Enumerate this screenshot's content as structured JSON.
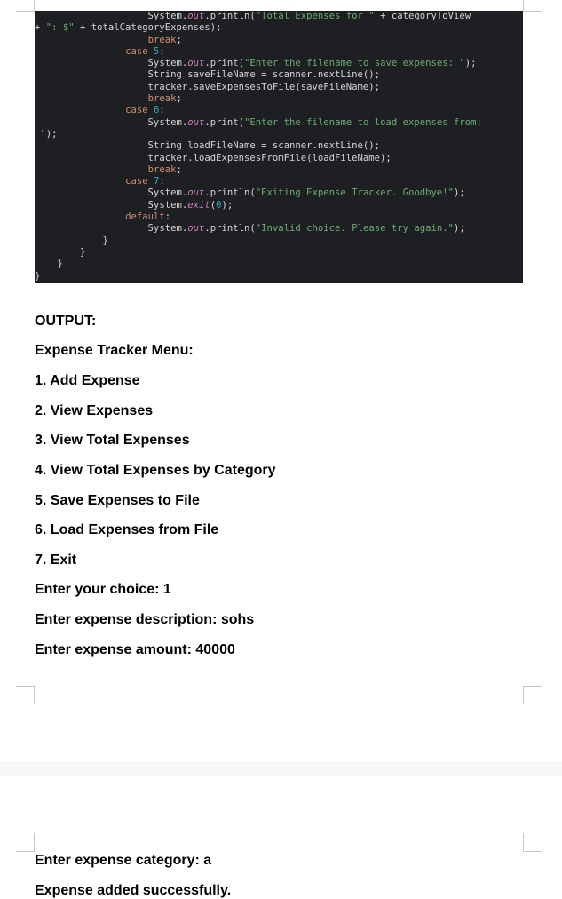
{
  "code_lines": [
    [
      {
        "t": "                    System."
      },
      {
        "t": "out",
        "c": "fld"
      },
      {
        "t": ".println("
      },
      {
        "t": "\"Total Expenses for \"",
        "c": "str"
      },
      {
        "t": " + categoryToView"
      }
    ],
    [
      {
        "t": "+ "
      },
      {
        "t": "\": $\"",
        "c": "str"
      },
      {
        "t": " + totalCategoryExpenses);"
      }
    ],
    [
      {
        "t": "                    "
      },
      {
        "t": "break",
        "c": "kw"
      },
      {
        "t": ";"
      }
    ],
    [
      {
        "t": "                "
      },
      {
        "t": "case ",
        "c": "kw"
      },
      {
        "t": "5",
        "c": "num"
      },
      {
        "t": ":"
      }
    ],
    [
      {
        "t": "                    System."
      },
      {
        "t": "out",
        "c": "fld"
      },
      {
        "t": ".print("
      },
      {
        "t": "\"Enter the filename to save expenses: \"",
        "c": "str"
      },
      {
        "t": ");"
      }
    ],
    [
      {
        "t": "                    String saveFileName = scanner.nextLine();"
      }
    ],
    [
      {
        "t": "                    tracker.saveExpensesToFile(saveFileName);"
      }
    ],
    [
      {
        "t": "                    "
      },
      {
        "t": "break",
        "c": "kw"
      },
      {
        "t": ";"
      }
    ],
    [
      {
        "t": "                "
      },
      {
        "t": "case ",
        "c": "kw"
      },
      {
        "t": "6",
        "c": "num"
      },
      {
        "t": ":"
      }
    ],
    [
      {
        "t": "                    System."
      },
      {
        "t": "out",
        "c": "fld"
      },
      {
        "t": ".print("
      },
      {
        "t": "\"Enter the filename to load expenses from:",
        "c": "str"
      }
    ],
    [
      {
        "t": " "
      },
      {
        "t": "\"",
        "c": "str"
      },
      {
        "t": ");"
      }
    ],
    [
      {
        "t": "                    String loadFileName = scanner.nextLine();"
      }
    ],
    [
      {
        "t": "                    tracker.loadExpensesFromFile(loadFileName);"
      }
    ],
    [
      {
        "t": "                    "
      },
      {
        "t": "break",
        "c": "kw"
      },
      {
        "t": ";"
      }
    ],
    [
      {
        "t": "                "
      },
      {
        "t": "case ",
        "c": "kw"
      },
      {
        "t": "7",
        "c": "num"
      },
      {
        "t": ":"
      }
    ],
    [
      {
        "t": "                    System."
      },
      {
        "t": "out",
        "c": "fld"
      },
      {
        "t": ".println("
      },
      {
        "t": "\"Exiting Expense Tracker. Goodbye!\"",
        "c": "str"
      },
      {
        "t": ");"
      }
    ],
    [
      {
        "t": "                    System."
      },
      {
        "t": "exit",
        "c": "fld"
      },
      {
        "t": "("
      },
      {
        "t": "0",
        "c": "num"
      },
      {
        "t": ");"
      }
    ],
    [
      {
        "t": "                "
      },
      {
        "t": "default",
        "c": "kw"
      },
      {
        "t": ":"
      }
    ],
    [
      {
        "t": "                    System."
      },
      {
        "t": "out",
        "c": "fld"
      },
      {
        "t": ".println("
      },
      {
        "t": "\"Invalid choice. Please try again.\"",
        "c": "str"
      },
      {
        "t": ");"
      }
    ],
    [
      {
        "t": "            }"
      }
    ],
    [
      {
        "t": "        }"
      }
    ],
    [
      {
        "t": "    }"
      }
    ],
    [
      {
        "t": "}"
      }
    ]
  ],
  "output_page1": {
    "heading": "OUTPUT:",
    "menu_title": "Expense Tracker Menu:",
    "option1": "1. Add Expense",
    "option2": "2. View Expenses",
    "option3": "3. View Total Expenses",
    "option4": "4. View Total Expenses by Category",
    "option5": "5. Save Expenses to File",
    "option6": "6. Load Expenses from File",
    "option7": "7. Exit",
    "choice": "Enter your choice: 1",
    "description": "Enter expense description: sohs",
    "amount": "Enter expense amount: 40000"
  },
  "output_page2": {
    "category": "Enter expense category: a",
    "added": "Expense added successfully."
  }
}
